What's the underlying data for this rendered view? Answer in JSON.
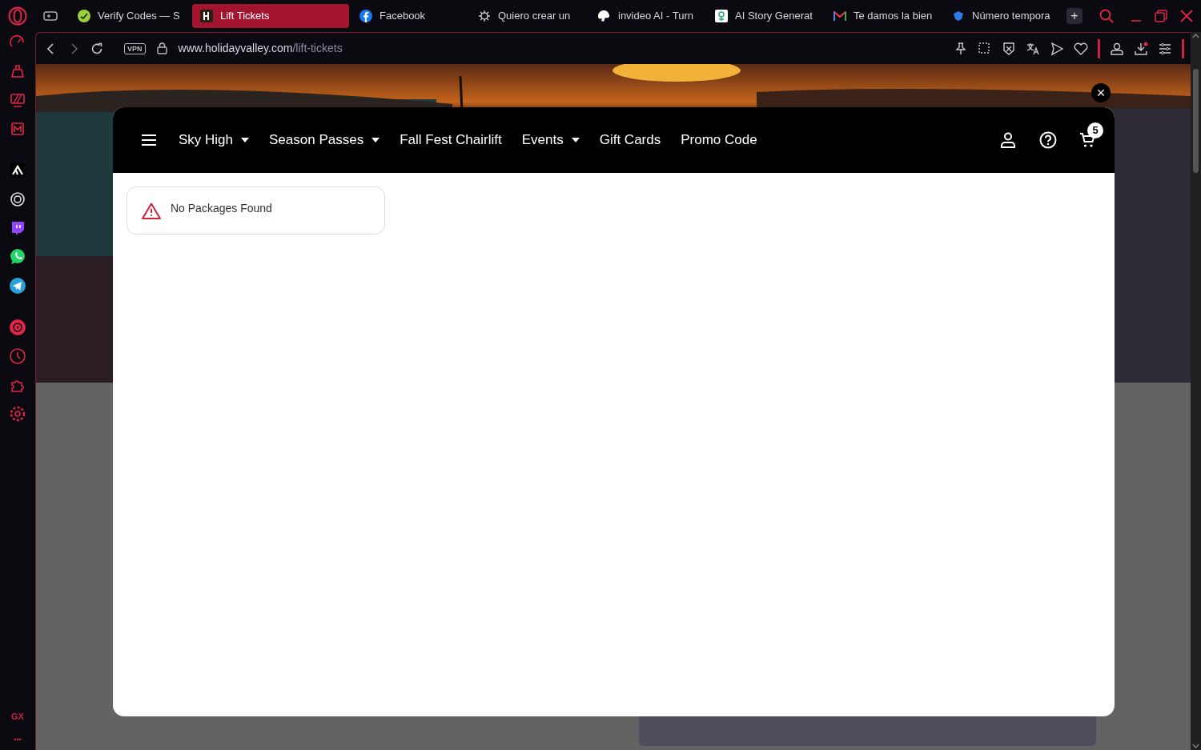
{
  "tabs": [
    {
      "label": "Verify Codes — S",
      "selected": false
    },
    {
      "label": "Lift Tickets",
      "selected": true
    },
    {
      "label": "Facebook",
      "selected": false
    },
    {
      "label": "Quiero crear un",
      "selected": false
    },
    {
      "label": "invideo AI - Turn",
      "selected": false
    },
    {
      "label": "AI Story Generat",
      "selected": false
    },
    {
      "label": "Te damos la bien",
      "selected": false
    },
    {
      "label": "Número tempora",
      "selected": false
    }
  ],
  "new_tab": "+",
  "address_bar": {
    "vpn": "VPN",
    "host": "www.holidayvalley.com",
    "path": "/lift-tickets"
  },
  "sidebar": {
    "gx": "GX",
    "more": "•••"
  },
  "modal": {
    "close": "×",
    "nav": [
      {
        "label": "Sky High",
        "dropdown": true
      },
      {
        "label": "Season Passes",
        "dropdown": true
      },
      {
        "label": "Fall Fest Chairlift",
        "dropdown": false
      },
      {
        "label": "Events",
        "dropdown": true
      },
      {
        "label": "Gift Cards",
        "dropdown": false
      },
      {
        "label": "Promo Code",
        "dropdown": false
      }
    ],
    "cart_count": "5",
    "alert": "No Packages Found"
  }
}
